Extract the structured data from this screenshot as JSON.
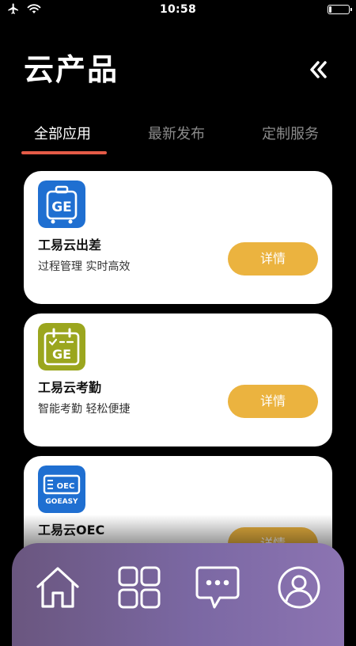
{
  "status_bar": {
    "time": "10:58",
    "icons": [
      "airplane-icon",
      "wifi-icon",
      "battery-icon"
    ]
  },
  "header": {
    "title": "云产品",
    "collapse_icon": "double-chevron-left-icon"
  },
  "tabs": [
    {
      "label": "全部应用",
      "active": true
    },
    {
      "label": "最新发布",
      "active": false
    },
    {
      "label": "定制服务",
      "active": false
    }
  ],
  "cards": [
    {
      "icon_text": "GE",
      "name": "工易云出差",
      "desc": "过程管理 实时高效",
      "button": "详情",
      "icon_color": "#1f6fd1"
    },
    {
      "icon_text": "GE",
      "name": "工易云考勤",
      "desc": "智能考勤 轻松便捷",
      "button": "详情",
      "icon_color": "#9ba61e"
    },
    {
      "icon_text": "OEC",
      "icon_subtext": "GOEASY",
      "name": "工易云OEC",
      "desc": "",
      "button": "详情",
      "icon_color": "#1f6fd1"
    }
  ],
  "bottom_nav": [
    {
      "name": "home-icon"
    },
    {
      "name": "grid-icon"
    },
    {
      "name": "message-icon"
    },
    {
      "name": "profile-icon"
    }
  ],
  "colors": {
    "accent_underline": "#e45b47",
    "detail_button": "#ebb33f",
    "nav_gradient_start": "#6a567f",
    "nav_gradient_end": "#8c74b2"
  }
}
